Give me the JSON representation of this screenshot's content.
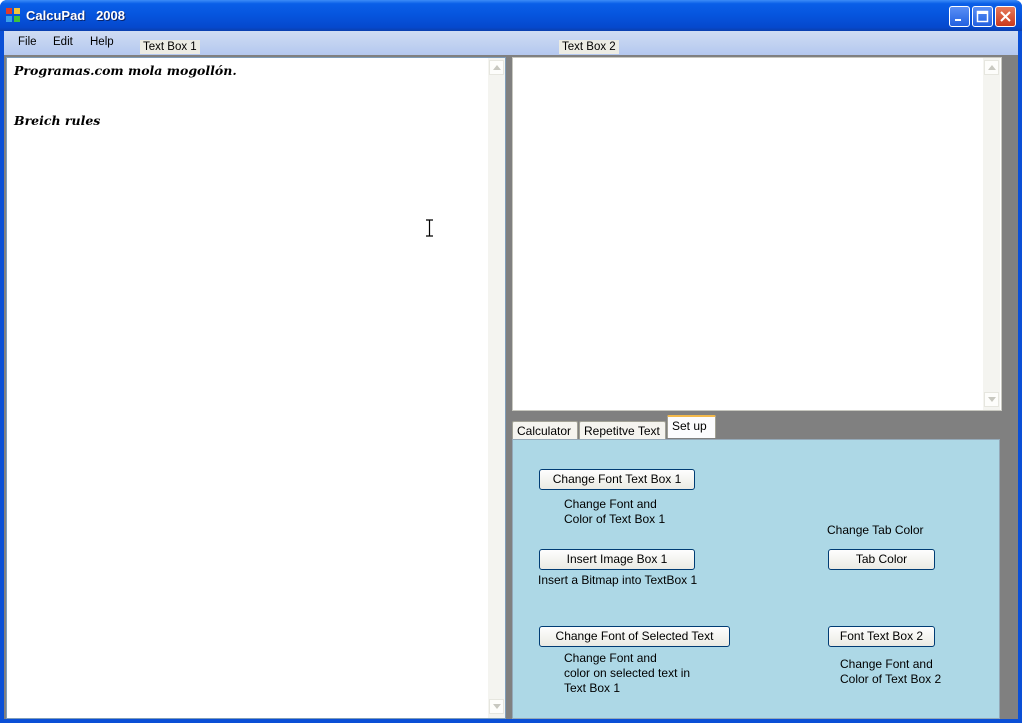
{
  "window": {
    "title": "CalcuPad   2008",
    "controls": {
      "minimize": "minimize",
      "maximize": "maximize",
      "close": "close"
    }
  },
  "menu": {
    "file": "File",
    "edit": "Edit",
    "help": "Help"
  },
  "labels": {
    "textbox1": "Text Box 1",
    "textbox2": "Text Box 2"
  },
  "textbox1": {
    "lines": [
      "Programas.com mola mogollón.",
      "Breich rules"
    ]
  },
  "textbox2": {
    "content": ""
  },
  "tabs": [
    {
      "label": "Calculator",
      "active": false
    },
    {
      "label": "Repetitve Text",
      "active": false
    },
    {
      "label": "Set up",
      "active": true
    }
  ],
  "setup": {
    "change_font_tb1_button": "Change Font Text Box 1",
    "change_font_tb1_desc": "Change Font and\nColor of Text Box 1",
    "insert_image_button": "Insert Image Box 1",
    "insert_image_desc": "Insert a Bitmap into TextBox 1",
    "change_font_selected_button": "Change Font of Selected Text",
    "change_font_selected_desc": "Change Font and\ncolor on selected text in\nText Box 1",
    "change_tab_color_label": "Change Tab Color",
    "tab_color_button": "Tab Color",
    "font_tb2_button": "Font Text Box 2",
    "font_tb2_desc": "Change Font and\nColor of Text Box 2"
  },
  "colors": {
    "titlebar": "#0654dd",
    "menubar": "#c4d5f3",
    "panel_background": "#add8e6",
    "active_tab_highlight": "#f3b94b"
  }
}
